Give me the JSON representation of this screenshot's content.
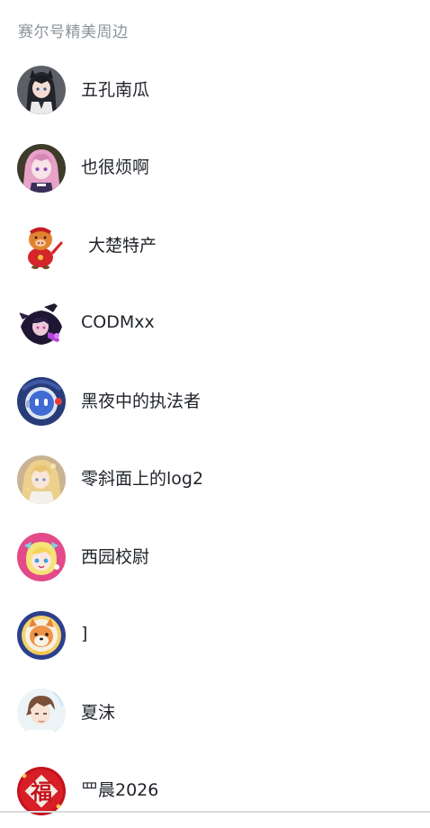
{
  "section_title": "赛尔号精美周边",
  "users": [
    {
      "name": "五孔南瓜",
      "avatar": "anime-girl-dark-hair-avatar"
    },
    {
      "name": "也很烦啊",
      "avatar": "anime-girl-pink-hair-avatar"
    },
    {
      "name": "大楚特产",
      "avatar": "red-pig-mascot-avatar"
    },
    {
      "name": "CODMxx",
      "avatar": "dark-anime-character-avatar"
    },
    {
      "name": "黑夜中的执法者",
      "avatar": "blue-robot-avatar"
    },
    {
      "name": "零斜面上的log2",
      "avatar": "blonde-anime-girl-avatar"
    },
    {
      "name": "西园校尉",
      "avatar": "pink-chibi-character-avatar"
    },
    {
      "name": "]",
      "avatar": "shiba-dog-avatar"
    },
    {
      "name": "夏沫",
      "avatar": "anime-boy-avatar"
    },
    {
      "name": "罒晨2026",
      "avatar": "red-fu-character-avatar"
    }
  ]
}
